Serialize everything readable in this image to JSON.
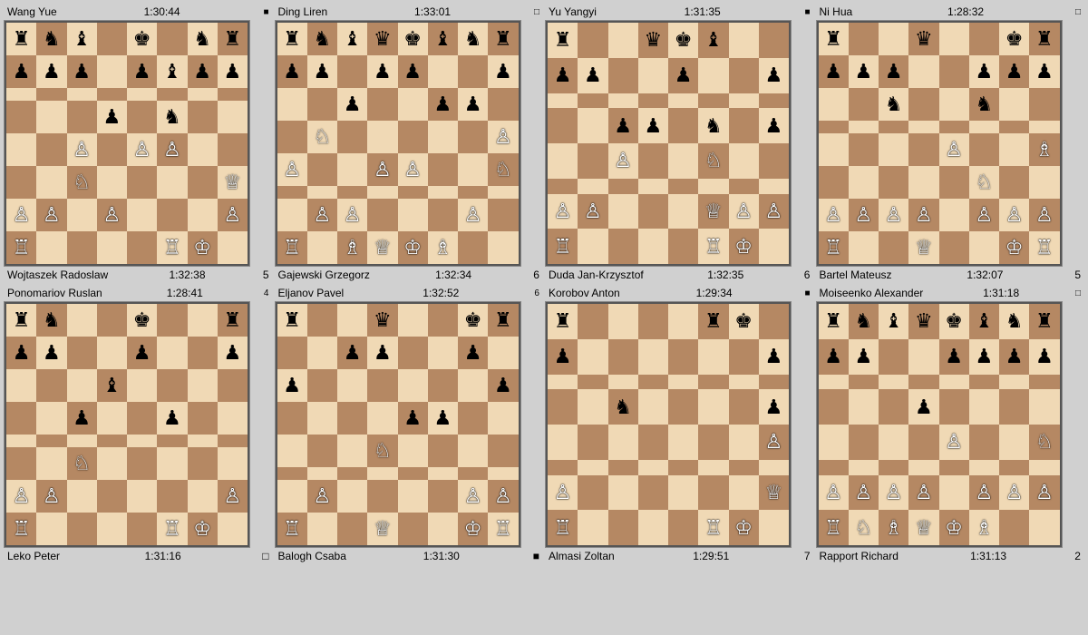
{
  "games": [
    {
      "top_player": "Wang Yue",
      "top_time": "1:30:44",
      "top_status": "■",
      "bottom_player": "Wojtaszek Radoslaw",
      "bottom_time": "1:32:38",
      "bottom_moves": "5",
      "board": [
        [
          "br",
          "bn",
          "bb",
          ".",
          "bk",
          ".",
          "bn",
          "br"
        ],
        [
          "bp",
          "bp",
          "bp",
          ".",
          "bp",
          "bb",
          "bp",
          "bp"
        ],
        [
          ".",
          ".",
          ".",
          ".",
          ".",
          ".",
          ".",
          "."
        ],
        [
          ".",
          ".",
          ".",
          "bp",
          ".",
          "bn",
          ".",
          "."
        ],
        [
          ".",
          ".",
          "wp",
          ".",
          "wp",
          "wp",
          ".",
          "."
        ],
        [
          ".",
          ".",
          "wn",
          ".",
          ".",
          ".",
          ".",
          "wq"
        ],
        [
          "wp",
          "wp",
          ".",
          "wp",
          ".",
          ".",
          ".",
          "wp"
        ],
        [
          "wr",
          ".",
          ".",
          ".",
          ".",
          "wr",
          "wk",
          "."
        ]
      ]
    },
    {
      "top_player": "Ding Liren",
      "top_time": "1:33:01",
      "top_status": "□",
      "bottom_player": "Gajewski Grzegorz",
      "bottom_time": "1:32:34",
      "bottom_moves": "6",
      "board": [
        [
          "br",
          "bn",
          "bb",
          "bq",
          "bk",
          "bb",
          "bn",
          "br"
        ],
        [
          "bp",
          "bp",
          ".",
          "bp",
          "bp",
          ".",
          ".",
          "bp"
        ],
        [
          ".",
          ".",
          "bp",
          ".",
          ".",
          "bp",
          "bp",
          "."
        ],
        [
          ".",
          "wn",
          ".",
          ".",
          ".",
          ".",
          ".",
          "wp"
        ],
        [
          "wp",
          ".",
          ".",
          "wp",
          "wp",
          ".",
          ".",
          "wn"
        ],
        [
          ".",
          ".",
          ".",
          ".",
          ".",
          ".",
          ".",
          "."
        ],
        [
          ".",
          "wp",
          "wp",
          ".",
          ".",
          ".",
          "wp",
          "."
        ],
        [
          "wr",
          ".",
          "wb",
          "wq",
          "wk",
          "wb",
          ".",
          "."
        ]
      ]
    },
    {
      "top_player": "Yu Yangyi",
      "top_time": "1:31:35",
      "top_status": "■",
      "bottom_player": "Duda Jan-Krzysztof",
      "bottom_time": "1:32:35",
      "bottom_moves": "6",
      "board": [
        [
          "br",
          ".",
          ".",
          "bq",
          "bk",
          "bb",
          ".",
          "."
        ],
        [
          "bp",
          "bp",
          ".",
          ".",
          "bp",
          ".",
          ".",
          "bp"
        ],
        [
          ".",
          ".",
          ".",
          ".",
          ".",
          ".",
          ".",
          "."
        ],
        [
          ".",
          ".",
          "bp",
          "bp",
          ".",
          "bn",
          ".",
          "bp"
        ],
        [
          ".",
          ".",
          "wp",
          ".",
          ".",
          "wn",
          ".",
          "."
        ],
        [
          ".",
          ".",
          ".",
          ".",
          ".",
          ".",
          ".",
          "."
        ],
        [
          "wp",
          "wp",
          ".",
          ".",
          ".",
          "wq",
          "wp",
          "wp"
        ],
        [
          "wr",
          ".",
          ".",
          ".",
          ".",
          "wr",
          "wk",
          "."
        ]
      ]
    },
    {
      "top_player": "Ni Hua",
      "top_time": "1:28:32",
      "top_status": "□",
      "bottom_player": "Bartel Mateusz",
      "bottom_time": "1:32:07",
      "bottom_moves": "5",
      "board": [
        [
          "br",
          ".",
          ".",
          "bq",
          ".",
          ".",
          "bk",
          "br"
        ],
        [
          "bp",
          "bp",
          "bp",
          ".",
          ".",
          "bp",
          "bp",
          "bp"
        ],
        [
          ".",
          ".",
          "bn",
          ".",
          ".",
          "bn",
          ".",
          "."
        ],
        [
          ".",
          ".",
          ".",
          ".",
          ".",
          ".",
          ".",
          "."
        ],
        [
          ".",
          ".",
          ".",
          ".",
          "wp",
          ".",
          ".",
          "wb"
        ],
        [
          ".",
          ".",
          ".",
          ".",
          ".",
          "wn",
          ".",
          "."
        ],
        [
          "wp",
          "wp",
          "wp",
          "wp",
          ".",
          "wp",
          "wp",
          "wp"
        ],
        [
          "wr",
          ".",
          ".",
          "wq",
          ".",
          ".",
          "wk",
          "wr"
        ]
      ]
    },
    {
      "top_player": "Ponomariov Ruslan",
      "top_time": "1:28:41",
      "top_status": "4",
      "bottom_player": "Leko Peter",
      "bottom_time": "1:31:16",
      "bottom_moves": "□",
      "board": [
        [
          "br",
          "bn",
          ".",
          ".",
          "bk",
          ".",
          ".",
          "br"
        ],
        [
          "bp",
          "bp",
          ".",
          ".",
          "bp",
          ".",
          ".",
          "bp"
        ],
        [
          ".",
          ".",
          ".",
          "bb",
          ".",
          ".",
          ".",
          "."
        ],
        [
          ".",
          ".",
          "bp",
          ".",
          ".",
          "bp",
          ".",
          "."
        ],
        [
          ".",
          ".",
          ".",
          ".",
          ".",
          ".",
          ".",
          "."
        ],
        [
          ".",
          ".",
          "wn",
          ".",
          ".",
          ".",
          ".",
          "."
        ],
        [
          "wp",
          "wp",
          ".",
          ".",
          ".",
          ".",
          ".",
          "wp"
        ],
        [
          "wr",
          ".",
          ".",
          ".",
          ".",
          "wr",
          "wk",
          "."
        ]
      ]
    },
    {
      "top_player": "Eljanov Pavel",
      "top_time": "1:32:52",
      "top_status": "6",
      "bottom_player": "Balogh Csaba",
      "bottom_time": "1:31:30",
      "bottom_moves": "■",
      "board": [
        [
          "br",
          ".",
          ".",
          "bq",
          ".",
          ".",
          "bk",
          "br"
        ],
        [
          ".",
          ".",
          "bp",
          "bp",
          ".",
          ".",
          "bp",
          "."
        ],
        [
          "bp",
          ".",
          ".",
          ".",
          ".",
          ".",
          ".",
          "bp"
        ],
        [
          ".",
          ".",
          ".",
          ".",
          "bp",
          "bp",
          ".",
          "."
        ],
        [
          ".",
          ".",
          ".",
          "wn",
          ".",
          ".",
          ".",
          "."
        ],
        [
          ".",
          ".",
          ".",
          ".",
          ".",
          ".",
          ".",
          "."
        ],
        [
          ".",
          "wp",
          ".",
          ".",
          ".",
          ".",
          "wp",
          "wp"
        ],
        [
          "wr",
          ".",
          ".",
          "wq",
          ".",
          ".",
          "wk",
          "wr"
        ]
      ]
    },
    {
      "top_player": "Korobov Anton",
      "top_time": "1:29:34",
      "top_status": "■",
      "bottom_player": "Almasi Zoltan",
      "bottom_time": "1:29:51",
      "bottom_moves": "7",
      "board": [
        [
          "br",
          ".",
          ".",
          ".",
          ".",
          "br",
          "bk",
          "."
        ],
        [
          "bp",
          ".",
          ".",
          ".",
          ".",
          ".",
          ".",
          "bp"
        ],
        [
          ".",
          ".",
          ".",
          ".",
          ".",
          ".",
          ".",
          "."
        ],
        [
          ".",
          ".",
          "bn",
          ".",
          ".",
          ".",
          ".",
          "bp"
        ],
        [
          ".",
          ".",
          ".",
          ".",
          ".",
          ".",
          ".",
          "wp"
        ],
        [
          ".",
          ".",
          ".",
          ".",
          ".",
          ".",
          ".",
          "."
        ],
        [
          "wp",
          ".",
          ".",
          ".",
          ".",
          ".",
          ".",
          "wq"
        ],
        [
          "wr",
          ".",
          ".",
          ".",
          ".",
          "wr",
          "wk",
          "."
        ]
      ]
    },
    {
      "top_player": "Moiseenko Alexander",
      "top_time": "1:31:18",
      "top_status": "□",
      "bottom_player": "Rapport Richard",
      "bottom_time": "1:31:13",
      "bottom_moves": "2",
      "board": [
        [
          "br",
          "bn",
          "bb",
          "bq",
          "bk",
          "bb",
          "bn",
          "br"
        ],
        [
          "bp",
          "bp",
          ".",
          ".",
          "bp",
          "bp",
          "bp",
          "bp"
        ],
        [
          ".",
          ".",
          ".",
          ".",
          ".",
          ".",
          ".",
          "."
        ],
        [
          ".",
          ".",
          ".",
          "bp",
          ".",
          ".",
          ".",
          "."
        ],
        [
          ".",
          ".",
          ".",
          ".",
          "wp",
          ".",
          ".",
          "wn"
        ],
        [
          ".",
          ".",
          ".",
          ".",
          ".",
          ".",
          ".",
          "."
        ],
        [
          "wp",
          "wp",
          "wp",
          "wp",
          ".",
          "wp",
          "wp",
          "wp"
        ],
        [
          "wr",
          "wn",
          "wb",
          "wq",
          "wk",
          "wb",
          ".",
          "."
        ]
      ]
    }
  ],
  "pieces": {
    "wr": "♖",
    "wn": "♘",
    "wb": "♗",
    "wq": "♕",
    "wk": "♔",
    "wp": "♙",
    "br": "♜",
    "bn": "♞",
    "bb": "♝",
    "bq": "♛",
    "bk": "♚",
    "bp": "♟",
    ".": ""
  }
}
